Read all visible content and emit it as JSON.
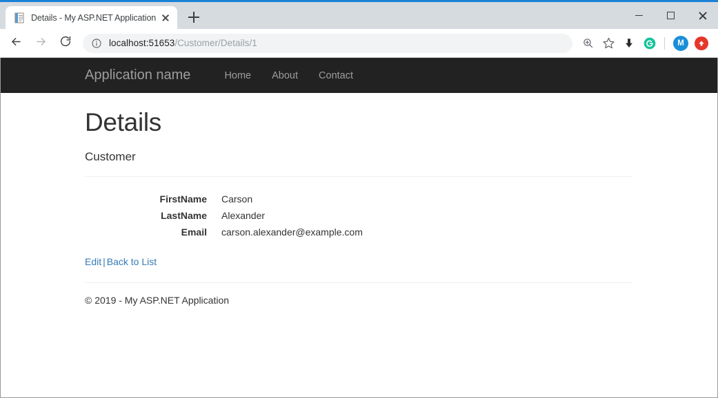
{
  "browser": {
    "tab": {
      "title": "Details - My ASP.NET Application",
      "favicon": "page-icon",
      "close": "close-icon"
    },
    "new_tab": "+",
    "window_controls": {
      "minimize": "minimize-icon",
      "maximize": "maximize-icon",
      "close": "close-icon"
    },
    "nav": {
      "back": "back-arrow-icon",
      "forward": "forward-arrow-icon",
      "reload": "reload-icon"
    },
    "omnibox": {
      "info": "info-circle-icon",
      "url_host": "localhost:51653",
      "url_path": "/Customer/Details/1",
      "full_url": "localhost:51653/Customer/Details/1"
    },
    "toolbar_icons": [
      {
        "name": "zoom-icon",
        "glyph": "magnifier"
      },
      {
        "name": "bookmark-star-icon",
        "glyph": "star"
      },
      {
        "name": "downloads-icon",
        "glyph": "down-arrow"
      },
      {
        "name": "grammarly-icon",
        "glyph": "G",
        "color": "#15c39a"
      },
      {
        "name": "profile-avatar",
        "glyph": "M",
        "color": "#1a8fd8"
      },
      {
        "name": "update-icon",
        "glyph": "up-arrow",
        "color": "#e5362b"
      }
    ]
  },
  "page": {
    "navbar": {
      "brand": "Application name",
      "links": [
        {
          "label": "Home"
        },
        {
          "label": "About"
        },
        {
          "label": "Contact"
        }
      ],
      "background": "#222222",
      "link_color": "#9d9d9d"
    },
    "title": "Details",
    "subtitle": "Customer",
    "details": [
      {
        "term": "FirstName",
        "desc": "Carson"
      },
      {
        "term": "LastName",
        "desc": "Alexander"
      },
      {
        "term": "Email",
        "desc": "carson.alexander@example.com"
      }
    ],
    "actions": {
      "edit": "Edit",
      "separator": "|",
      "back_to_list": "Back to List",
      "link_color": "#337ab7"
    },
    "footer": {
      "copyright": "© 2019 - My ASP.NET Application"
    }
  }
}
